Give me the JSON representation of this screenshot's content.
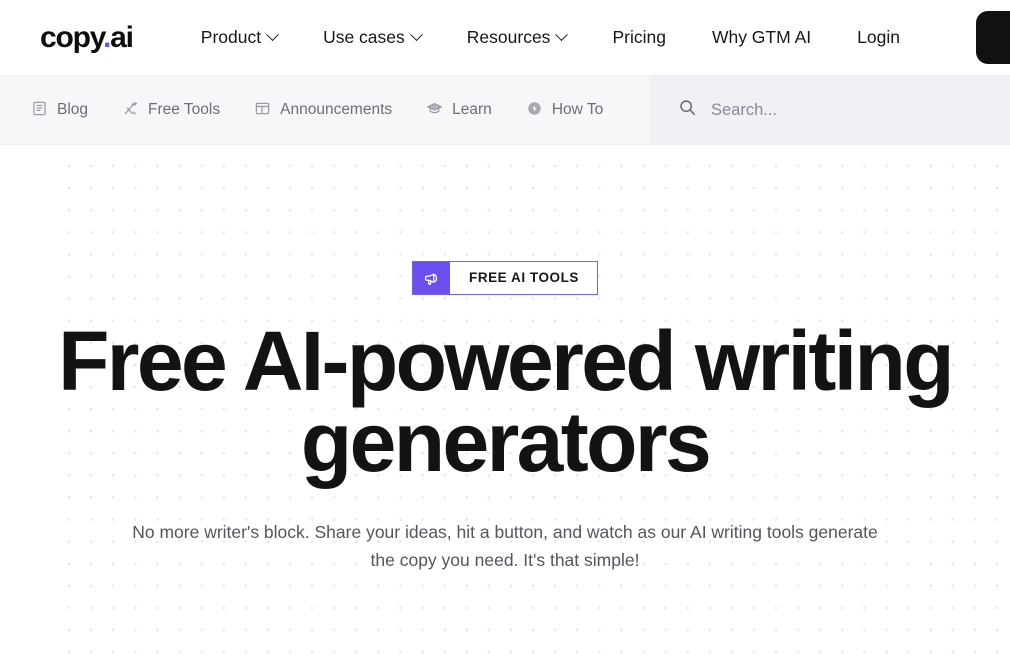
{
  "brand": {
    "name_first": "copy",
    "name_dot": ".",
    "name_last": "ai"
  },
  "topnav": {
    "links": [
      {
        "label": "Product",
        "caret": true
      },
      {
        "label": "Use cases",
        "caret": true
      },
      {
        "label": "Resources",
        "caret": true
      },
      {
        "label": "Pricing",
        "caret": false
      },
      {
        "label": "Why GTM AI",
        "caret": false
      },
      {
        "label": "Login",
        "caret": false
      }
    ],
    "cta_label": ""
  },
  "subnav": {
    "items": [
      {
        "label": "Blog",
        "icon": "book-icon"
      },
      {
        "label": "Free Tools",
        "icon": "tools-icon"
      },
      {
        "label": "Announcements",
        "icon": "layout-icon"
      },
      {
        "label": "Learn",
        "icon": "graduation-cap-icon"
      },
      {
        "label": "How To",
        "icon": "bolt-circle-icon"
      }
    ],
    "search": {
      "icon": "search-icon",
      "placeholder": "Search..."
    }
  },
  "hero": {
    "badge": {
      "icon": "megaphone-icon",
      "label": "FREE AI TOOLS"
    },
    "headline_line1": "Free AI-powered writing",
    "headline_line2": "generators",
    "subhead_line1": "No more writer's block. Share your ideas, hit a button, and watch as our AI writing tools generate",
    "subhead_line2": "the copy you need. It's that simple!"
  },
  "colors": {
    "accent_purple": "#6c4ff0",
    "logo_dot": "#6f4ff2",
    "text_dark": "#131315",
    "text_muted": "#55555f",
    "subnav_bg": "#f7f7fa",
    "search_bg": "#f0f0f5",
    "cta_dark": "#111113",
    "dot_grid": "#e6e6ee"
  }
}
